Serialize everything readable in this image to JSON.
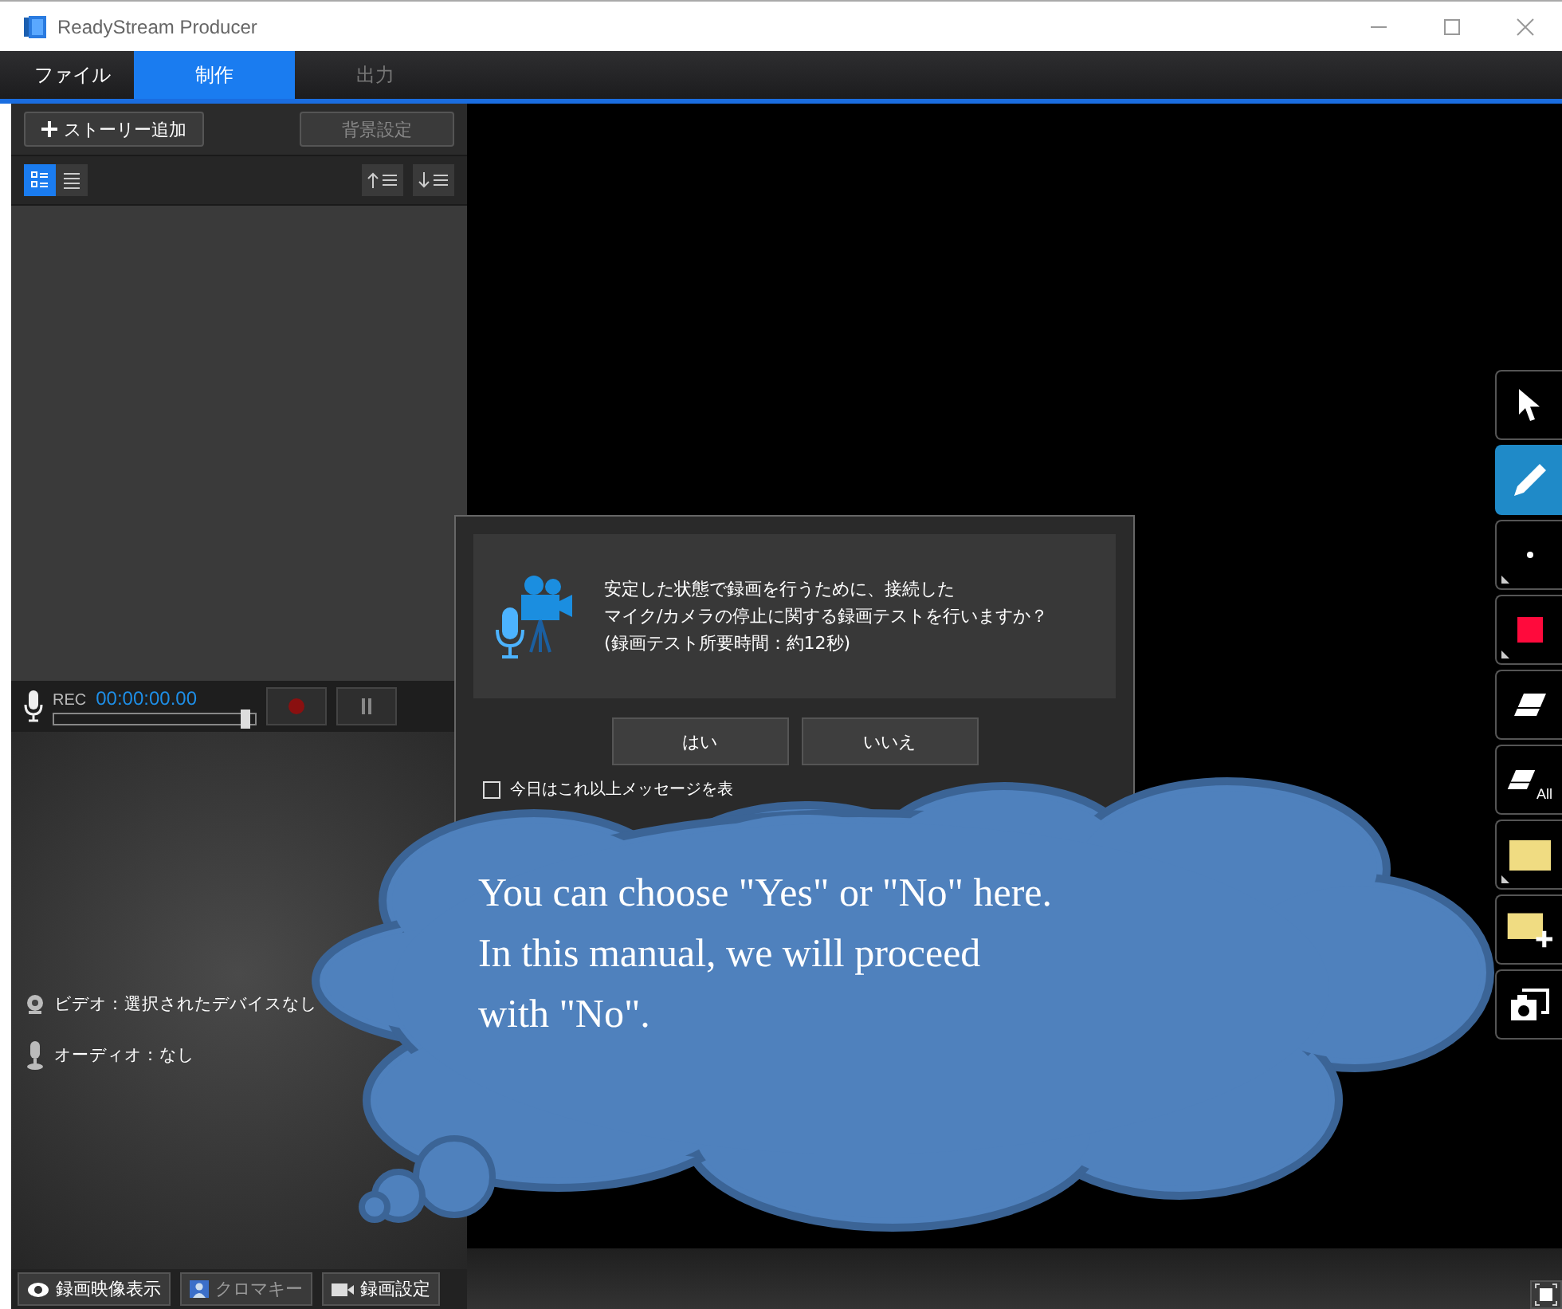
{
  "window": {
    "title": "ReadyStream Producer"
  },
  "tabs": [
    {
      "label": "ファイル",
      "selected": false,
      "disabled": false
    },
    {
      "label": "制作",
      "selected": true,
      "disabled": false
    },
    {
      "label": "出力",
      "selected": false,
      "disabled": true
    }
  ],
  "story_toolbar": {
    "add_button": {
      "label": "ストーリー追加",
      "disabled": false
    },
    "background_button": {
      "label": "背景設定",
      "disabled": true
    }
  },
  "view_modes": [
    {
      "selected": true
    },
    {
      "selected": false
    }
  ],
  "recorder": {
    "label": "REC",
    "time": "00:00:00.00",
    "level": 0.95
  },
  "preview": {
    "video": "ビデオ：選択されたデバイスなし",
    "audio": "オーディオ：なし"
  },
  "bottom_buttons": [
    {
      "kind": "eye",
      "label": "録画映像表示",
      "disabled": false
    },
    {
      "kind": "person",
      "label": "クロマキー",
      "disabled": true
    },
    {
      "kind": "camera",
      "label": "録画設定",
      "disabled": false
    }
  ],
  "tools": [
    {
      "kind": "pointer",
      "selected": false
    },
    {
      "kind": "pen",
      "selected": true
    },
    {
      "kind": "dot",
      "selected": false
    },
    {
      "kind": "swatch",
      "selected": false,
      "color": "#ff0a3c"
    },
    {
      "kind": "eraser",
      "selected": false
    },
    {
      "kind": "eraser-all",
      "selected": false,
      "label": "All"
    },
    {
      "kind": "note",
      "selected": false
    },
    {
      "kind": "note-add",
      "selected": false
    },
    {
      "kind": "capture",
      "selected": false
    }
  ],
  "dialog": {
    "message": [
      "安定した状態で録画を行うために、接続した",
      "マイク/カメラの停止に関する録画テストを行いますか？",
      "(録画テスト所要時間：約12秒)"
    ],
    "buttons": [
      "はい",
      "いいえ"
    ],
    "checkbox": {
      "label": "今日はこれ以上メッセージを表",
      "checked": false
    }
  },
  "callout": {
    "lines": [
      "You can choose \"Yes\" or \"No\" here.",
      "In this manual, we will proceed",
      "with \"No\"."
    ]
  }
}
